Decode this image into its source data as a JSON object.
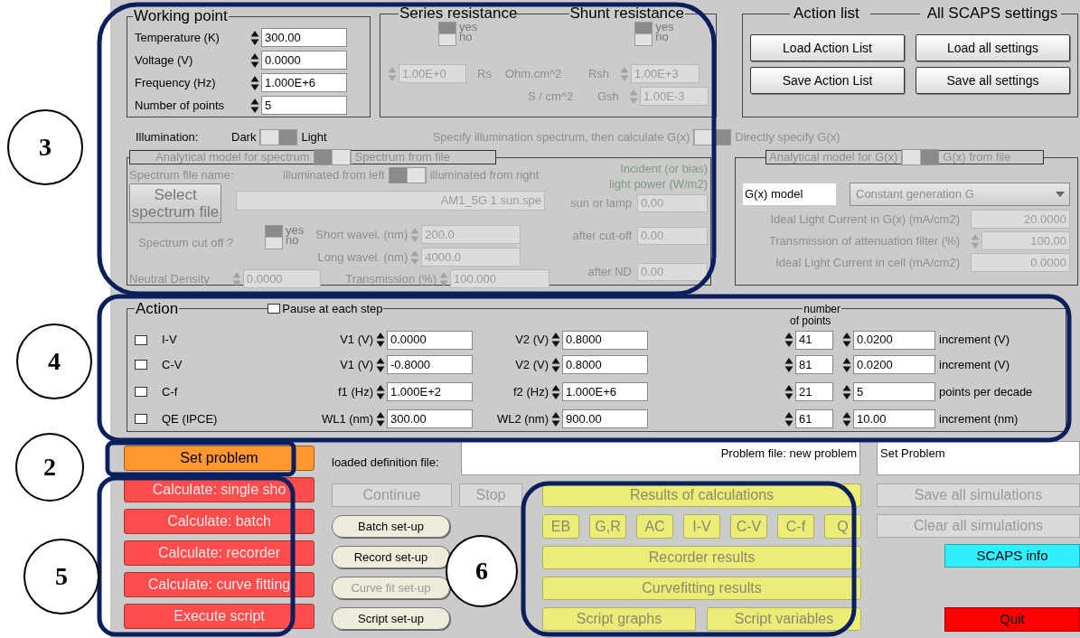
{
  "callouts": [
    {
      "label": "3"
    },
    {
      "label": "4"
    },
    {
      "label": "2"
    },
    {
      "label": "5"
    },
    {
      "label": "6"
    }
  ],
  "working_point": {
    "title": "Working point",
    "fields": [
      {
        "label": "Temperature (K)",
        "value": "300.00"
      },
      {
        "label": "Voltage (V)",
        "value": "0.0000"
      },
      {
        "label": "Frequency (Hz)",
        "value": "1.000E+6"
      },
      {
        "label": "Number of points",
        "value": "5"
      }
    ]
  },
  "series_resistance": {
    "title": "Series resistance",
    "switch": {
      "yes": "yes",
      "no": "no",
      "on": true
    },
    "value": "1.00E+0",
    "symbol": "Rs",
    "unit": "Ohm.cm^2",
    "conductance_unit": "S / cm^2"
  },
  "shunt_resistance": {
    "title": "Shunt resistance",
    "switch": {
      "yes": "yes",
      "no": "no",
      "on": true
    },
    "rows": [
      {
        "symbol": "Rsh",
        "value": "1.00E+3"
      },
      {
        "symbol": "Gsh",
        "value": "1.00E-3"
      }
    ]
  },
  "action_list": {
    "title": "Action list",
    "buttons": [
      "Load Action List",
      "Save Action List"
    ]
  },
  "all_settings": {
    "title": "All SCAPS settings",
    "buttons": [
      "Load all settings",
      "Save all settings"
    ]
  },
  "illumination": {
    "label": "Illumination:",
    "left": "Dark",
    "right": "Light",
    "right_on": true
  },
  "generation_mode": {
    "left": "Specify illumination spectrum, then calculate G(x)",
    "right": "Directly specify G(x)",
    "right_on": true
  },
  "spectrum": {
    "header": {
      "left": "Analytical model for spectrum",
      "right": "Spectrum from file",
      "right_on": false
    },
    "file_label": "Spectrum file name:",
    "direction": {
      "left": "illuminated from left",
      "right": "illuminated from right",
      "right_on": false
    },
    "power_title": [
      "Incident (or bias)",
      "light power (W/m2)"
    ],
    "select_button": "Select spectrum file",
    "file": "AM1_5G 1 sun.spe",
    "cutoff": {
      "label": "Spectrum cut off ?",
      "yes": "yes",
      "no": "no",
      "on": true
    },
    "wavelengths": [
      {
        "label": "Short wavel. (nm)",
        "value": "200.0"
      },
      {
        "label": "Long wavel. (nm)",
        "value": "4000.0"
      }
    ],
    "nd": {
      "label": "Neutral Density",
      "value": "0.0000"
    },
    "transmission": {
      "label": "Transmission (%)",
      "value": "100.000"
    },
    "powers": [
      {
        "label": "sun or lamp",
        "value": "0.00"
      },
      {
        "label": "after cut-off",
        "value": "0.00"
      },
      {
        "label": "after ND",
        "value": "0.00"
      }
    ]
  },
  "generation": {
    "header": {
      "left": "Analytical model for G(x)",
      "right": "G(x) from file",
      "right_on": true
    },
    "model_label": "G(x) model",
    "model": "Constant generation G",
    "rows": [
      {
        "label": "Ideal Light Current in G(x) (mA/cm2)",
        "value": "20.0000",
        "kind": "readout"
      },
      {
        "label": "Transmission of attenuation filter (%)",
        "value": "100.00",
        "kind": "spinner"
      },
      {
        "label": "Ideal Light Current in cell (mA/cm2)",
        "value": "0.0000",
        "kind": "readout"
      }
    ]
  },
  "action": {
    "title": "Action",
    "pause": {
      "label": "Pause at each step",
      "checked": false
    },
    "points_header": [
      "number",
      "of points"
    ],
    "rows": [
      {
        "name": "I-V",
        "checked": false,
        "start_label": "V1 (V)",
        "start": "0.0000",
        "stop_label": "V2 (V)",
        "stop": "0.8000",
        "points": "41",
        "step": "0.0200",
        "step_label": "increment (V)"
      },
      {
        "name": "C-V",
        "checked": false,
        "start_label": "V1 (V)",
        "start": "-0.8000",
        "stop_label": "V2 (V)",
        "stop": "0.8000",
        "points": "81",
        "step": "0.0200",
        "step_label": "increment (V)"
      },
      {
        "name": "C-f",
        "checked": false,
        "start_label": "f1 (Hz)",
        "start": "1.000E+2",
        "stop_label": "f2 (Hz)",
        "stop": "1.000E+6",
        "points": "21",
        "step": "5",
        "step_label": "points per decade"
      },
      {
        "name": "QE (IPCE)",
        "checked": false,
        "start_label": "WL1 (nm)",
        "start": "300.00",
        "stop_label": "WL2 (nm)",
        "stop": "900.00",
        "points": "61",
        "step": "10.00",
        "step_label": "increment (nm)"
      }
    ]
  },
  "control": {
    "set_problem": "Set problem",
    "calculate": [
      "Calculate: single sho",
      "Calculate: batch",
      "Calculate: recorder",
      "Calculate: curve fitting",
      "Execute script"
    ],
    "definition_label": "loaded definition file:",
    "definition_file": "Problem file: new problem",
    "status": "Set Problem",
    "continue": {
      "label": "Continue",
      "disabled": true
    },
    "stop": {
      "label": "Stop",
      "disabled": true
    },
    "setups": [
      {
        "label": "Batch set-up",
        "disabled": false
      },
      {
        "label": "Record set-up",
        "disabled": false
      },
      {
        "label": "Curve fit set-up",
        "disabled": true
      },
      {
        "label": "Script set-up",
        "disabled": false
      }
    ]
  },
  "results": {
    "title": "Results of calculations",
    "graphs": [
      "EB",
      "G,R",
      "AC",
      "I-V",
      "C-V",
      "C-f",
      "Q"
    ],
    "recorder": "Recorder results",
    "curvefitting": "Curvefitting results",
    "script_graphs": "Script graphs",
    "script_variables": "Script variables"
  },
  "simulations": [
    {
      "label": "Save all simulations",
      "disabled": true
    },
    {
      "label": "Clear all simulations",
      "disabled": true
    }
  ],
  "info": "SCAPS info",
  "quit": "Quit"
}
